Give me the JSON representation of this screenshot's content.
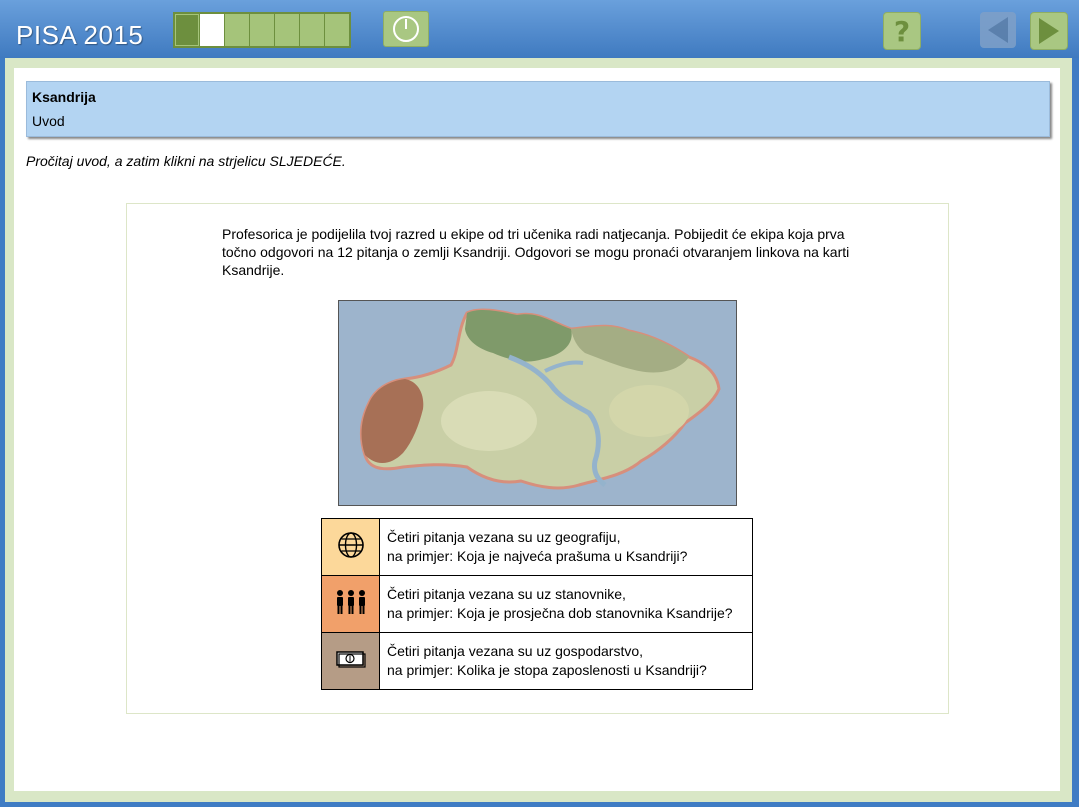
{
  "header": {
    "brand": "PISA 2015",
    "progress": {
      "total_segments": 7,
      "completed": 1,
      "current": 2
    },
    "timer_icon": "clock-icon",
    "help_label": "?",
    "back_icon": "arrow-left-icon",
    "next_icon": "arrow-right-icon"
  },
  "unit": {
    "title": "Ksandrija",
    "subtitle": "Uvod"
  },
  "instruction": "Pročitaj uvod, a zatim klikni na strjelicu SLJEDEĆE.",
  "stimulus": {
    "intro_text": "Profesorica je podijelila tvoj razred u ekipe od tri učenika radi natjecanja. Pobijedit će ekipa koja prva točno odgovori na 12 pitanja o zemlji Ksandriji. Odgovori se mogu pronaći otvaranjem linkova na karti Ksandrije.",
    "categories": [
      {
        "icon": "globe-icon",
        "color": "#fcd89a",
        "line1": "Četiri pitanja vezana su uz geografiju,",
        "line2": "na primjer: Koja je najveća prašuma u Ksandriji?"
      },
      {
        "icon": "people-icon",
        "color": "#f1a06a",
        "line1": "Četiri pitanja vezana su uz stanovnike,",
        "line2": "na primjer: Koja je prosječna dob stanovnika Ksandrije?"
      },
      {
        "icon": "money-icon",
        "color": "#b59c86",
        "line1": "Četiri pitanja vezana su uz gospodarstvo,",
        "line2": "na primjer: Kolika je stopa zaposlenosti u Ksandriji?"
      }
    ]
  },
  "colors": {
    "topbar": "#3f7ac0",
    "header_bg": "#b3d4f2",
    "accent_green": "#a9c782"
  }
}
